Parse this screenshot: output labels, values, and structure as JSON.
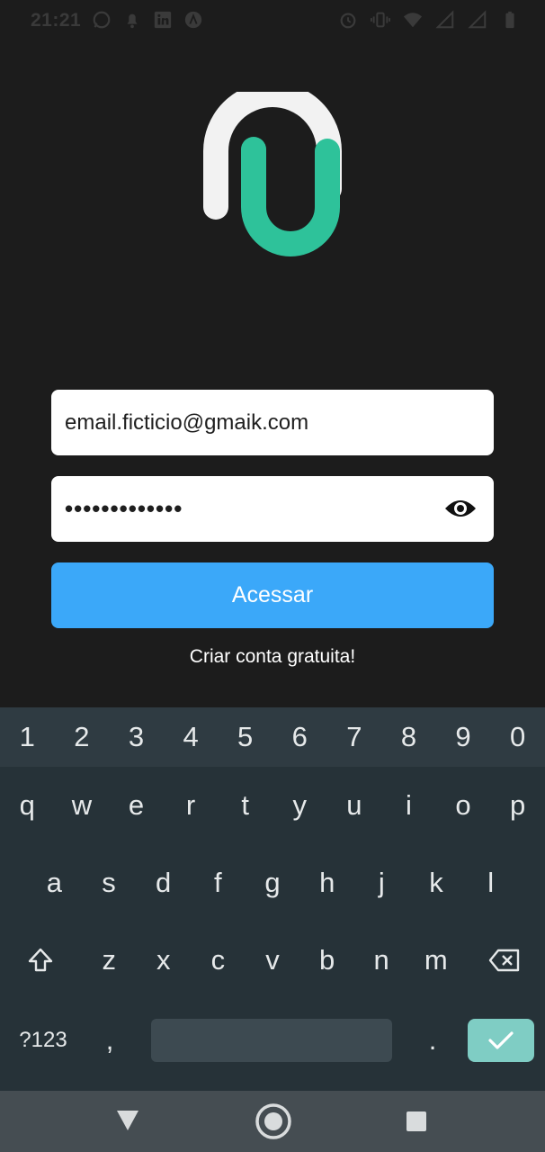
{
  "status_bar": {
    "time": "21:21",
    "left_icons": [
      "whatsapp-icon",
      "notification-icon",
      "linkedin-icon",
      "app-icon"
    ],
    "right_icons": [
      "alarm-icon",
      "vibrate-icon",
      "wifi-icon",
      "signal-icon",
      "signal-icon",
      "battery-icon"
    ]
  },
  "logo": {
    "colors": {
      "white": "#f2f2f2",
      "green": "#2ec29a"
    }
  },
  "form": {
    "email_value": "email.ficticio@gmaik.com",
    "password_value": "•••••••••••••",
    "password_toggle_icon": "eye-icon",
    "login_label": "Acessar",
    "signup_label": "Criar conta gratuita!"
  },
  "colors": {
    "accent": "#3ba8f9",
    "background": "#1c1c1c",
    "keyboard": "#263238",
    "enter": "#7fcdc4"
  },
  "keyboard": {
    "numbers": [
      "1",
      "2",
      "3",
      "4",
      "5",
      "6",
      "7",
      "8",
      "9",
      "0"
    ],
    "row1": [
      "q",
      "w",
      "e",
      "r",
      "t",
      "y",
      "u",
      "i",
      "o",
      "p"
    ],
    "row2": [
      "a",
      "s",
      "d",
      "f",
      "g",
      "h",
      "j",
      "k",
      "l"
    ],
    "row3": [
      "z",
      "x",
      "c",
      "v",
      "b",
      "n",
      "m"
    ],
    "symbols_label": "?123",
    "comma": ",",
    "period": "."
  },
  "nav_bar": {
    "icons": [
      "back-icon",
      "home-icon",
      "recents-icon"
    ]
  }
}
